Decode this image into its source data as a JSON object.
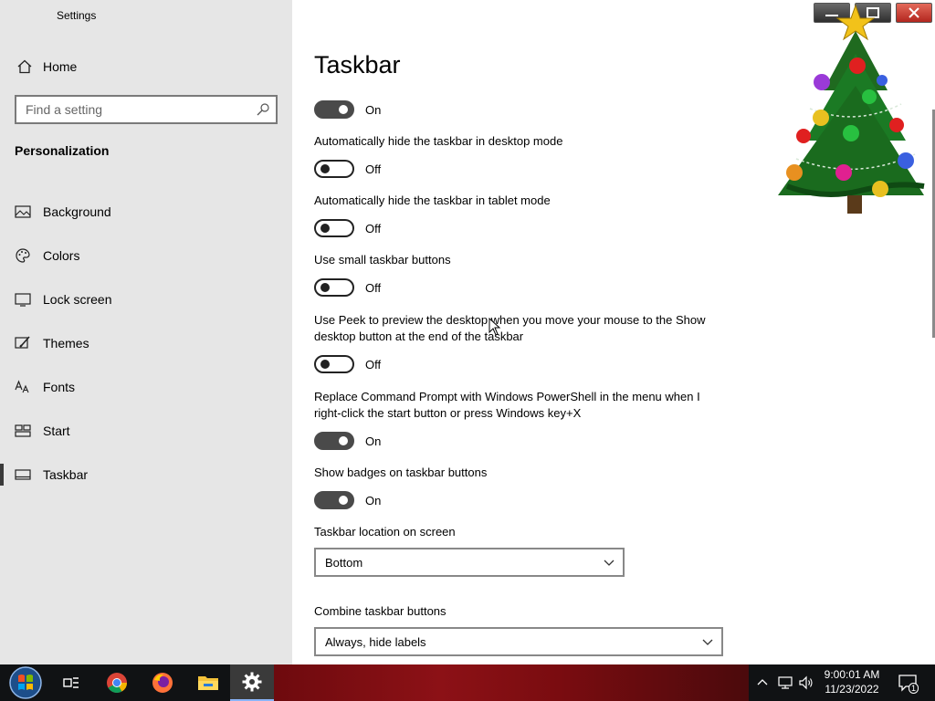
{
  "window": {
    "title": "Settings",
    "caption_buttons": [
      "minimize",
      "maximize",
      "close"
    ]
  },
  "sidebar": {
    "home_label": "Home",
    "search_placeholder": "Find a setting",
    "section_title": "Personalization",
    "items": [
      {
        "label": "Background",
        "icon": "image-icon"
      },
      {
        "label": "Colors",
        "icon": "palette-icon"
      },
      {
        "label": "Lock screen",
        "icon": "monitor-icon"
      },
      {
        "label": "Themes",
        "icon": "brush-icon"
      },
      {
        "label": "Fonts",
        "icon": "font-icon"
      },
      {
        "label": "Start",
        "icon": "tiles-icon"
      },
      {
        "label": "Taskbar",
        "icon": "taskbar-icon",
        "active": true
      }
    ]
  },
  "main": {
    "title": "Taskbar",
    "lock_toggle": {
      "state": "On"
    },
    "settings": [
      {
        "label": "Automatically hide the taskbar in desktop mode",
        "state": "Off"
      },
      {
        "label": "Automatically hide the taskbar in tablet mode",
        "state": "Off"
      },
      {
        "label": "Use small taskbar buttons",
        "state": "Off"
      },
      {
        "label": "Use Peek to preview the desktop when you move your mouse to the Show desktop button at the end of the taskbar",
        "state": "Off"
      },
      {
        "label": "Replace Command Prompt with Windows PowerShell in the menu when I right-click the start button or press Windows key+X",
        "state": "On"
      },
      {
        "label": "Show badges on taskbar buttons",
        "state": "On"
      }
    ],
    "location": {
      "label": "Taskbar location on screen",
      "value": "Bottom"
    },
    "combine": {
      "label": "Combine taskbar buttons",
      "value": "Always, hide labels"
    }
  },
  "taskbar": {
    "apps": [
      "start-orb-icon",
      "task-view-icon",
      "chrome-icon",
      "firefox-icon",
      "file-explorer-icon",
      "settings-gear-icon"
    ],
    "tray": [
      "chevron-up-icon",
      "network-icon",
      "volume-icon"
    ],
    "time": "9:00:01 AM",
    "date": "11/23/2022",
    "notification_count": "1"
  },
  "colors": {
    "sidebar_bg": "#e6e6e6",
    "toggle_on": "#4a4a4a",
    "taskbar_bg": "#101214",
    "wallpaper_red": "#8c1116"
  }
}
